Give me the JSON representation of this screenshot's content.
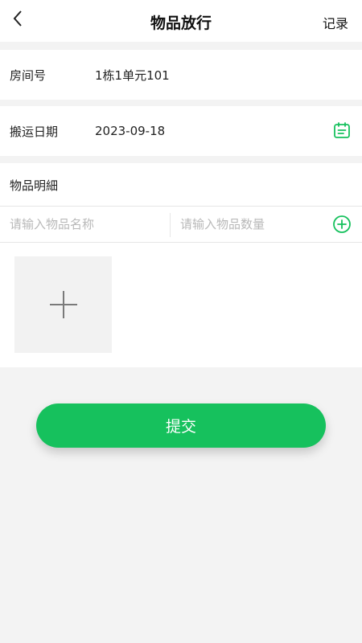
{
  "header": {
    "title": "物品放行",
    "right_link": "记录"
  },
  "room": {
    "label": "房间号",
    "value": "1栋1单元101"
  },
  "date": {
    "label": "搬运日期",
    "value": "2023-09-18"
  },
  "items": {
    "title": "物品明細",
    "name_placeholder": "请输入物品名称",
    "qty_placeholder": "请输入物品数量"
  },
  "submit": {
    "label": "提交"
  },
  "colors": {
    "accent": "#16c15d",
    "background": "#f3f3f3"
  },
  "icons": {
    "back": "chevron-left-icon",
    "calendar": "calendar-icon",
    "add": "plus-circle-icon",
    "upload": "plus-icon"
  }
}
